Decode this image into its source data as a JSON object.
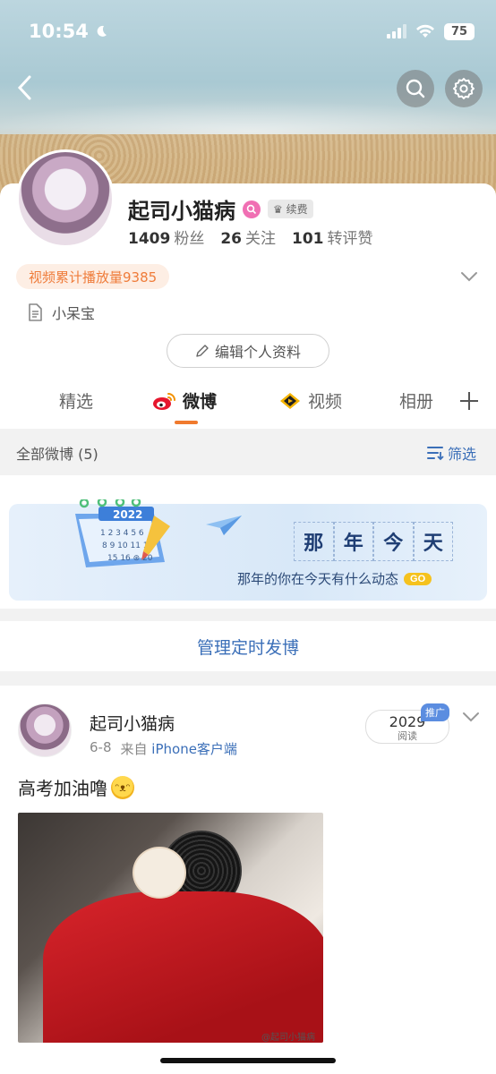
{
  "status_bar": {
    "time": "10:54",
    "battery": "75"
  },
  "profile": {
    "nickname": "起司小猫病",
    "renew_badge": "续费",
    "stats": [
      {
        "value": "1409",
        "label": "粉丝"
      },
      {
        "value": "26",
        "label": "关注"
      },
      {
        "value": "101",
        "label": "转评赞"
      }
    ],
    "play_count": "视频累计播放量9385",
    "bio": "小呆宝",
    "edit_button": "编辑个人资料"
  },
  "tabs": [
    {
      "label": "精选"
    },
    {
      "label": "微博",
      "active": true
    },
    {
      "label": "视频"
    },
    {
      "label": "相册"
    }
  ],
  "feed_header": {
    "all_label": "全部微博 (5)",
    "filter_label": "筛选"
  },
  "promo": {
    "calendar_year": "2022",
    "title_chars": [
      "那",
      "年",
      "今",
      "天"
    ],
    "subtitle": "那年的你在今天有什么动态",
    "go": "GO"
  },
  "manage_scheduled": "管理定时发博",
  "post": {
    "author": "起司小猫病",
    "date": "6-8",
    "source_prefix": "来自",
    "source": "iPhone客户端",
    "read_count": "2029",
    "read_label": "阅读",
    "promo_badge": "推广",
    "text": "高考加油噜",
    "watermark": "@起司小猫病"
  },
  "colors": {
    "accent": "#f07a2e",
    "link": "#3b6fb8",
    "vip": "#f06fb3"
  }
}
